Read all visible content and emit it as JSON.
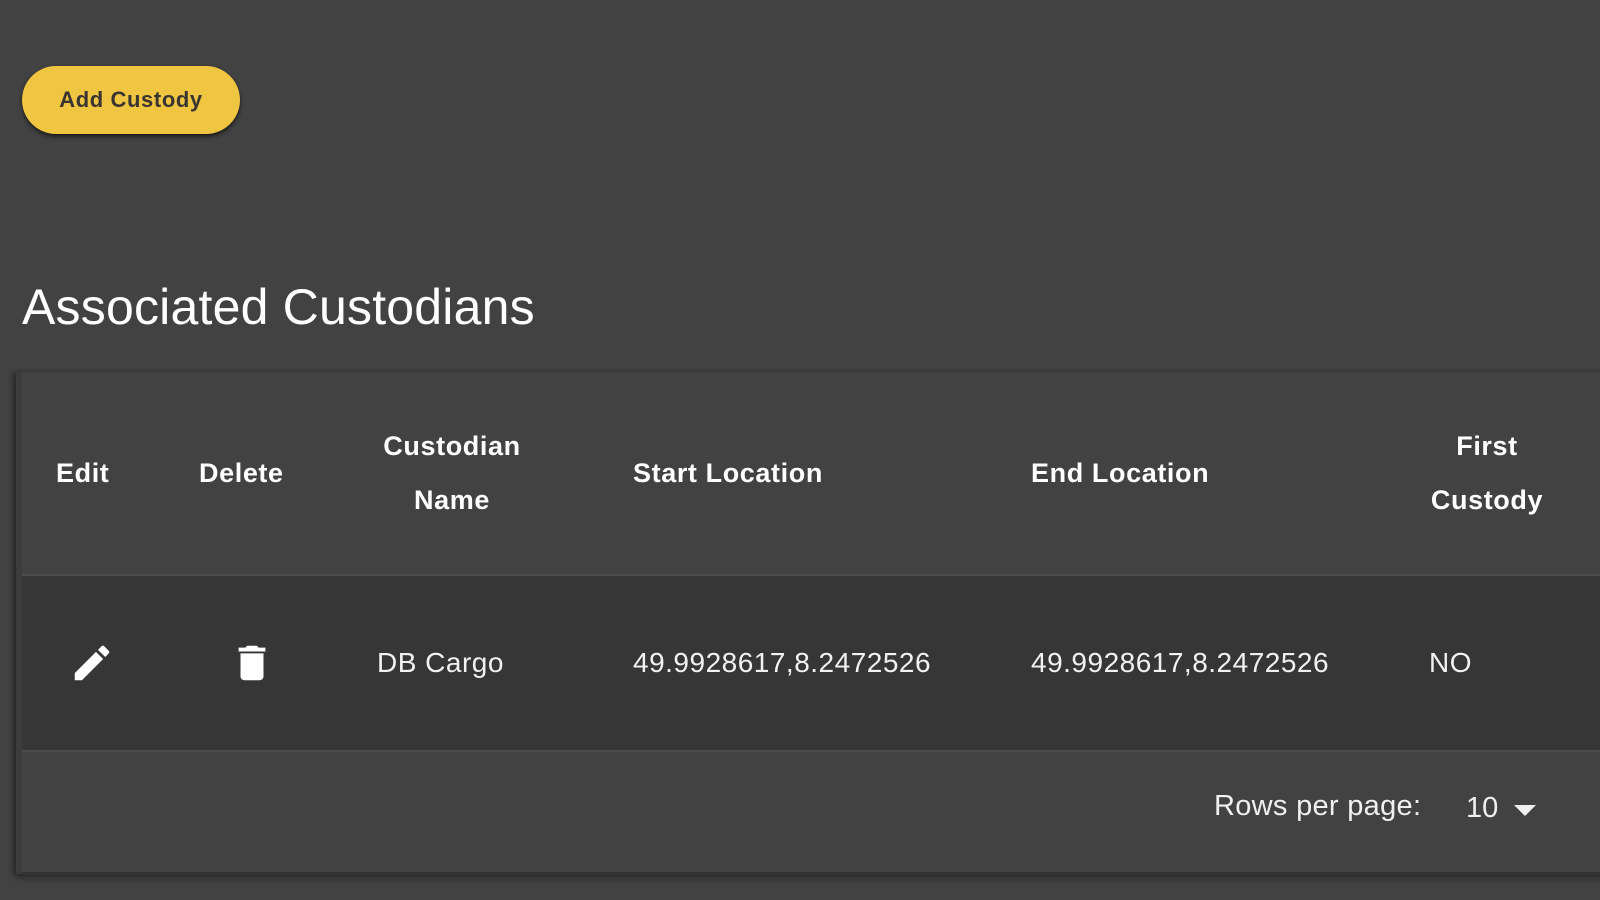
{
  "actions": {
    "add_custody_label": "Add Custody"
  },
  "section": {
    "title": "Associated Custodians"
  },
  "table": {
    "columns": [
      {
        "key": "edit",
        "label": "Edit"
      },
      {
        "key": "delete",
        "label": "Delete"
      },
      {
        "key": "custodian_name",
        "label_line1": "Custodian",
        "label_line2": "Name"
      },
      {
        "key": "start_location",
        "label": "Start Location"
      },
      {
        "key": "end_location",
        "label": "End Location"
      },
      {
        "key": "first_custody",
        "label_line1": "First",
        "label_line2": "Custody"
      }
    ],
    "rows": [
      {
        "edit_icon": "pencil-icon",
        "delete_icon": "trash-icon",
        "custodian_name": "DB Cargo",
        "start_location": "49.9928617,8.2472526",
        "end_location": "49.9928617,8.2472526",
        "first_custody": "NO"
      }
    ]
  },
  "pagination": {
    "rows_per_page_label": "Rows per page:",
    "rows_per_page_value": "10",
    "dropdown_icon": "caret-down-icon"
  },
  "colors": {
    "background": "#424242",
    "row_background": "#363636",
    "accent": "#f0c542",
    "accent_text": "#3a3530",
    "text": "#ffffff"
  }
}
